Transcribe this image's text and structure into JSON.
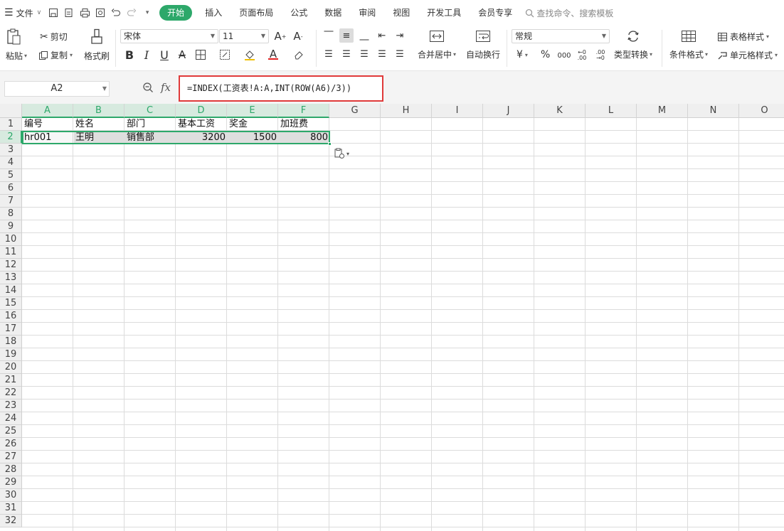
{
  "menubar": {
    "file_label": "文件",
    "tabs": [
      "开始",
      "插入",
      "页面布局",
      "公式",
      "数据",
      "审阅",
      "视图",
      "开发工具",
      "会员专享"
    ],
    "search_placeholder": "查找命令、搜索模板"
  },
  "ribbon": {
    "paste_label": "粘贴",
    "cut_label": "剪切",
    "copy_label": "复制",
    "format_painter_label": "格式刷",
    "font_name": "宋体",
    "font_size": "11",
    "bold": "B",
    "italic": "I",
    "underline": "U",
    "merge_center_label": "合并居中",
    "wrap_text_label": "自动换行",
    "number_format": "常规",
    "currency_symbol": "¥",
    "percent_symbol": "%",
    "type_convert_label": "类型转换",
    "conditional_format_label": "条件格式",
    "table_style_label": "表格样式",
    "cell_style_label": "单元格样式"
  },
  "formula_bar": {
    "name_box": "A2",
    "fx_label": "fx",
    "formula": "=INDEX(工资表!A:A,INT(ROW(A6)/3))"
  },
  "sheet": {
    "columns": [
      "A",
      "B",
      "C",
      "D",
      "E",
      "F",
      "G",
      "H",
      "I",
      "J",
      "K",
      "L",
      "M",
      "N",
      "O"
    ],
    "row_numbers": [
      "1",
      "2",
      "3",
      "4",
      "5",
      "6",
      "7",
      "8",
      "9",
      "10",
      "11",
      "12",
      "13",
      "14",
      "15",
      "16",
      "17",
      "18",
      "19",
      "20",
      "21",
      "22",
      "23",
      "24",
      "25",
      "26",
      "27",
      "28",
      "29",
      "30",
      "31",
      "32"
    ],
    "headers": [
      "编号",
      "姓名",
      "部门",
      "基本工资",
      "奖金",
      "加班费"
    ],
    "row2": [
      "hr001",
      "王明",
      "销售部",
      "3200",
      "1500",
      "800"
    ]
  },
  "colors": {
    "accent": "#2da86a",
    "highlight_box": "#e03a3a"
  }
}
